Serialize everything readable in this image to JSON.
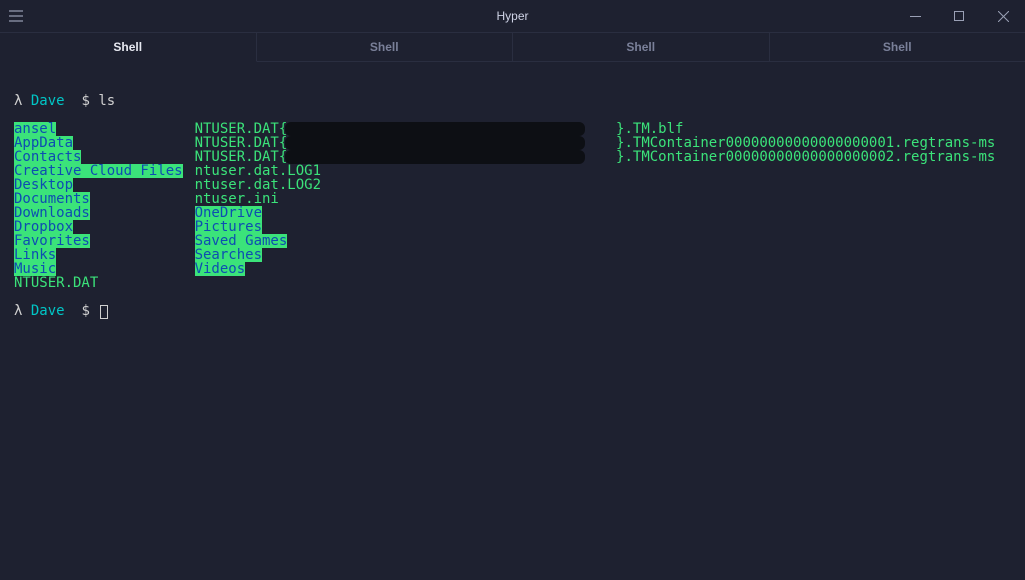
{
  "window": {
    "title": "Hyper"
  },
  "tabs": [
    {
      "label": "Shell",
      "active": true
    },
    {
      "label": "Shell",
      "active": false
    },
    {
      "label": "Shell",
      "active": false
    },
    {
      "label": "Shell",
      "active": false
    }
  ],
  "prompt": {
    "lambda": "λ",
    "user": "Dave",
    "sep": "$",
    "cmd": "ls"
  },
  "ls": {
    "col1_dirs": [
      "ansel",
      "AppData",
      "Contacts",
      "Creative Cloud Files",
      "Desktop",
      "Documents",
      "Downloads",
      "Dropbox",
      "Favorites",
      "Links",
      "Music"
    ],
    "col1_files": [
      "NTUSER.DAT"
    ],
    "col2_line1_prefix": "NTUSER.DAT{",
    "col2_line1_suffix": "}.TM.blf",
    "col2_line2_prefix": "NTUSER.DAT{",
    "col2_line2_suffix": "}.TMContainer00000000000000000001.regtrans-ms",
    "col2_line3_prefix": "NTUSER.DAT{",
    "col2_line3_suffix": "}.TMContainer00000000000000000002.regtrans-ms",
    "col2_files": [
      "ntuser.dat.LOG1",
      "ntuser.dat.LOG2",
      "ntuser.ini"
    ],
    "col2_dirs": [
      "OneDrive",
      "Pictures",
      "Saved Games",
      "Searches",
      "Videos"
    ]
  }
}
